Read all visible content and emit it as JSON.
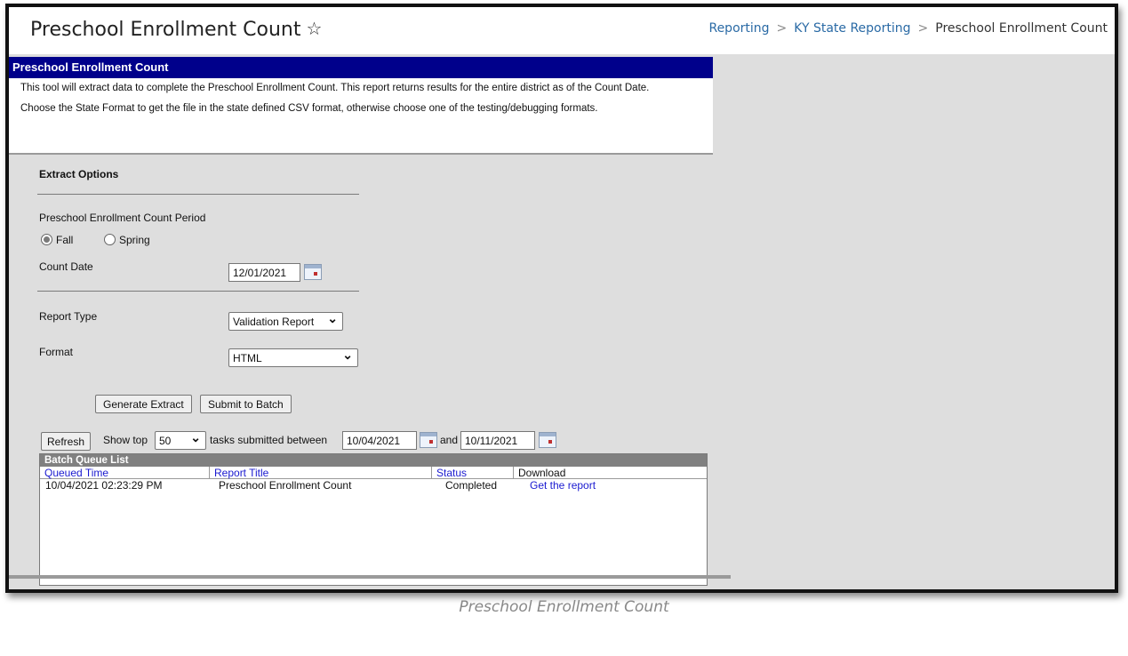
{
  "header": {
    "title": "Preschool Enrollment Count",
    "star_icon": "star-outline-icon",
    "breadcrumb": [
      "Reporting",
      "KY State Reporting",
      "Preschool Enrollment Count"
    ]
  },
  "tool": {
    "header": "Preschool Enrollment Count",
    "description": [
      "This tool will extract data to complete the Preschool Enrollment Count. This report returns results for the entire district as of the Count Date.",
      "Choose the State Format to get the file in the state defined CSV format, otherwise choose one of the testing/debugging formats."
    ]
  },
  "options": {
    "section_title": "Extract Options",
    "period_label": "Preschool Enrollment Count Period",
    "period_options": [
      {
        "label": "Fall",
        "checked": true
      },
      {
        "label": "Spring",
        "checked": false
      }
    ],
    "count_date_label": "Count Date",
    "count_date_value": "12/01/2021",
    "report_type_label": "Report Type",
    "report_type_value": "Validation Report",
    "format_label": "Format",
    "format_value": "HTML",
    "generate_button": "Generate Extract",
    "submit_button": "Submit to Batch"
  },
  "batch": {
    "refresh_button": "Refresh",
    "show_top_label": "Show top",
    "show_top_value": "50",
    "tasks_label": "tasks submitted between",
    "start_date": "10/04/2021",
    "and_label": "and",
    "end_date": "10/11/2021",
    "list_title": "Batch Queue List",
    "columns": [
      "Queued Time",
      "Report Title",
      "Status",
      "Download"
    ],
    "rows": [
      {
        "queued": "10/04/2021 02:23:29 PM",
        "title": "Preschool Enrollment Count",
        "status": "Completed",
        "download": "Get the report"
      }
    ]
  },
  "caption": "Preschool Enrollment Count",
  "colors": {
    "header_bg": "#00008b",
    "link": "#1a1ad0",
    "breadcrumb_link": "#2a6aa5",
    "panel_bg": "#dedede"
  }
}
